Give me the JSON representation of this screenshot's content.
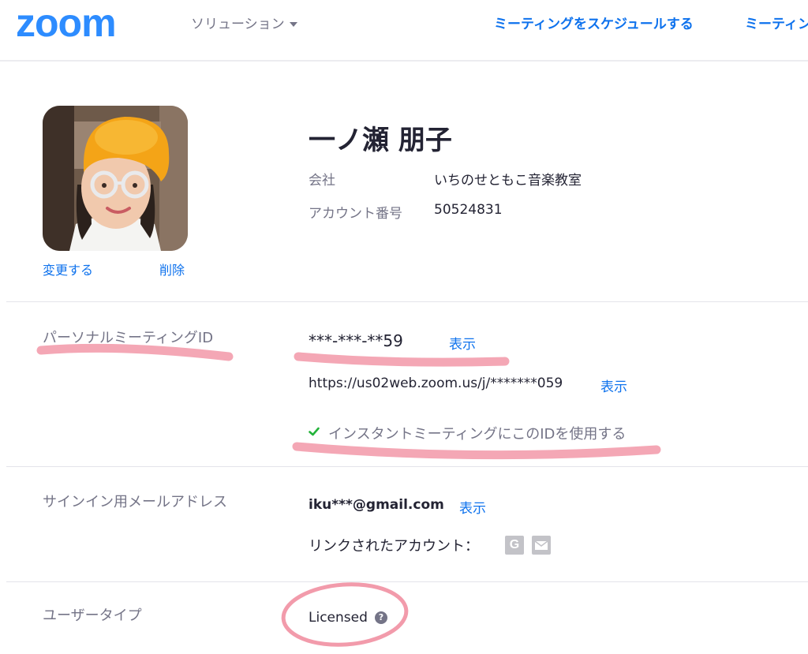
{
  "header": {
    "logo": "zoom",
    "nav_solutions": "ソリューション",
    "nav_schedule": "ミーティングをスケジュールする",
    "nav_join": "ミーティン"
  },
  "profile": {
    "name": "一ノ瀬 朋子",
    "change_label": "変更する",
    "delete_label": "削除",
    "company_label": "会社",
    "company_value": "いちのせともこ音楽教室",
    "account_number_label": "アカウント番号",
    "account_number_value": "50524831"
  },
  "pmi": {
    "label": "パーソナルミーティングID",
    "value": "***-***-**59",
    "show_label": "表示",
    "url": "https://us02web.zoom.us/j/*******059",
    "url_show_label": "表示",
    "instant_text": "インスタントミーティングにこのIDを使用する"
  },
  "email": {
    "label": "サインイン用メールアドレス",
    "value": "iku***@gmail.com",
    "show_label": "表示",
    "linked_accounts_label": "リンクされたアカウント：",
    "google_glyph": "G"
  },
  "user_type": {
    "label": "ユーザータイプ",
    "value": "Licensed",
    "help_glyph": "?"
  },
  "icons": {
    "caret": "chevron-down-icon",
    "check": "check-icon",
    "google": "google-icon",
    "mail": "mail-icon",
    "help": "help-icon"
  },
  "colors": {
    "brand": "#2d8cff",
    "link": "#0e72ed",
    "muted": "#747487",
    "text": "#232333",
    "check": "#23b33a",
    "highlight": "#f08a9c"
  }
}
